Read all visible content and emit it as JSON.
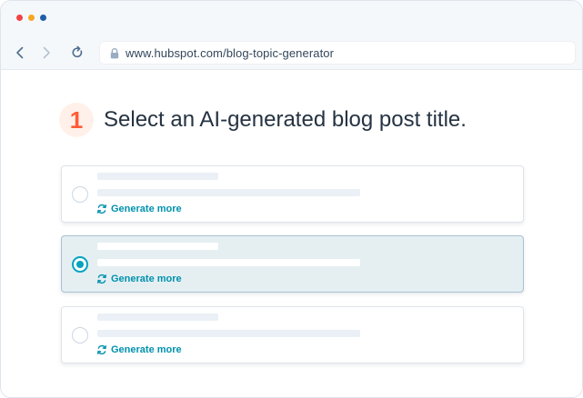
{
  "browser": {
    "url": "www.hubspot.com/blog-topic-generator"
  },
  "step": {
    "number": "1",
    "title": "Select an AI-generated blog post title."
  },
  "options": [
    {
      "generate_label": "Generate more",
      "selected": false
    },
    {
      "generate_label": "Generate more",
      "selected": true
    },
    {
      "generate_label": "Generate more",
      "selected": false
    }
  ],
  "colors": {
    "accent": "#00a4bd",
    "link": "#0091ae",
    "step_number": "#ff5c35",
    "step_badge_bg": "#fff1ea",
    "selected_card_bg": "#e5eff2"
  },
  "icons": {
    "back": "chevron-left-icon",
    "forward": "chevron-right-icon",
    "reload": "reload-icon",
    "lock": "lock-icon",
    "refresh": "refresh-icon"
  }
}
